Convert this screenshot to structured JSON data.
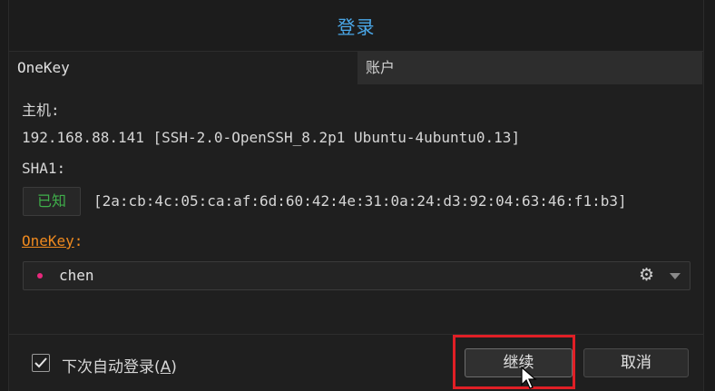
{
  "dialog": {
    "title": "登录"
  },
  "tabs": [
    {
      "label": "OneKey"
    },
    {
      "label": "账户"
    }
  ],
  "host": {
    "label": "主机:",
    "value": "192.168.88.141 [SSH-2.0-OpenSSH_8.2p1 Ubuntu-4ubuntu0.13]"
  },
  "sha1": {
    "label": "SHA1:",
    "status": "已知",
    "fingerprint": "[2a:cb:4c:05:ca:af:6d:60:42:4e:31:0a:24:d3:92:04:63:46:f1:b3]"
  },
  "onekey": {
    "label": "OneKey",
    "label_suffix": ":",
    "selected": "chen"
  },
  "footer": {
    "auto_login_label": "下次自动登录(",
    "auto_login_mnemonic": "A",
    "auto_login_close": ")",
    "auto_login_checked": true,
    "continue_label": "继续",
    "cancel_label": "取消"
  },
  "colors": {
    "title": "#4aa7e8",
    "known": "#3fae4a",
    "onekey_label": "#f08a1e",
    "dot": "#e8287c",
    "highlight": "#e01f26"
  },
  "icons": [
    "gear-icon",
    "chevron-down-icon",
    "checkmark-icon",
    "mouse-cursor-icon"
  ]
}
